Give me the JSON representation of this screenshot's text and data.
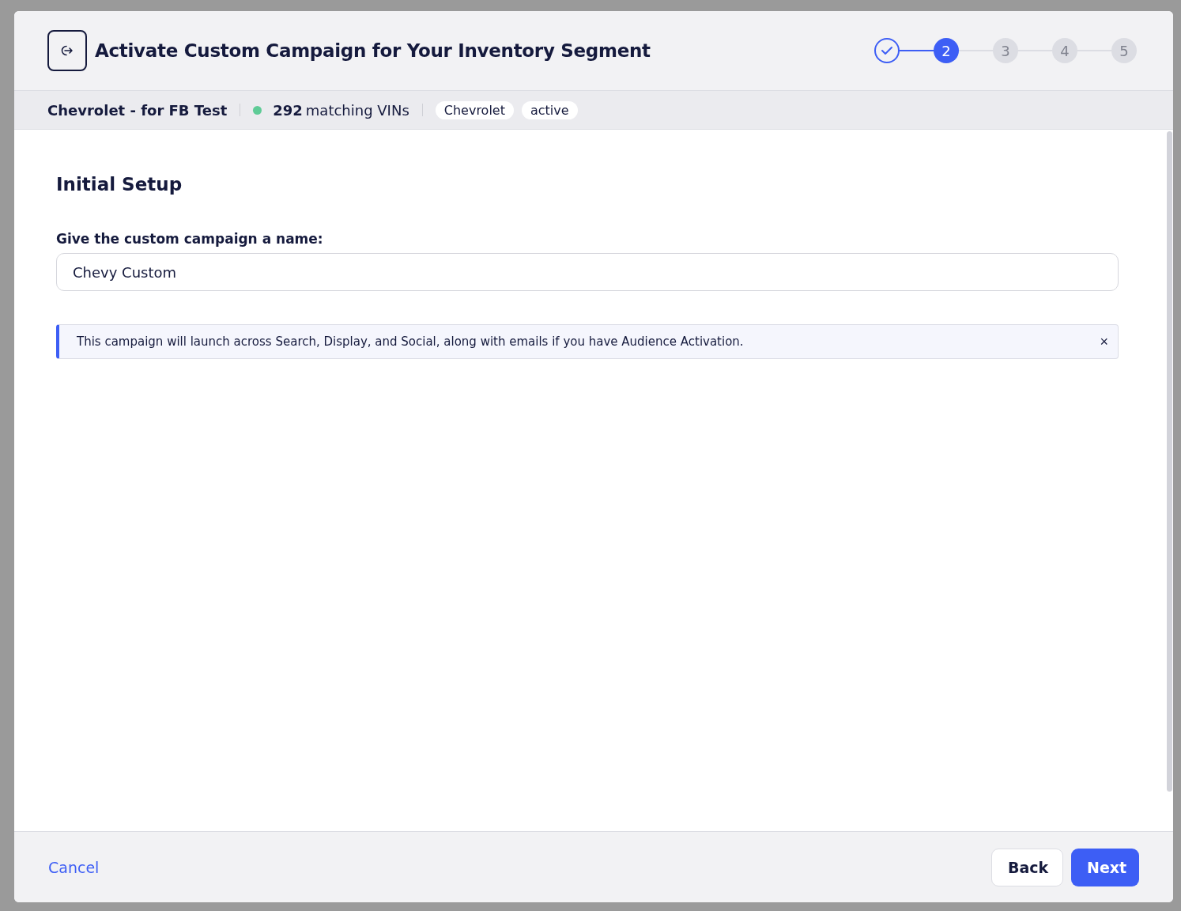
{
  "modal": {
    "title": "Activate Custom Campaign for Your Inventory Segment",
    "steps": [
      {
        "completed": true,
        "selected": false
      },
      {
        "label": "2",
        "completed": false,
        "selected": true
      },
      {
        "label": "3",
        "completed": false,
        "selected": false
      },
      {
        "label": "4",
        "completed": false,
        "selected": false
      },
      {
        "label": "5",
        "completed": false,
        "selected": false
      }
    ],
    "segment": {
      "name": "Chevrolet - for FB Test",
      "count": "292",
      "count_label": "matching VINs",
      "tags": [
        "Chevrolet",
        "active"
      ]
    },
    "section_title": "Initial Setup",
    "name_field": {
      "label": "Give the custom campaign a name:",
      "value": "Chevy Custom"
    },
    "notice": {
      "text": "This campaign will launch across Search, Display, and Social, along with emails if you have Audience Activation.",
      "close": "×"
    },
    "footer": {
      "cancel": "Cancel",
      "back": "Back",
      "next": "Next"
    }
  }
}
